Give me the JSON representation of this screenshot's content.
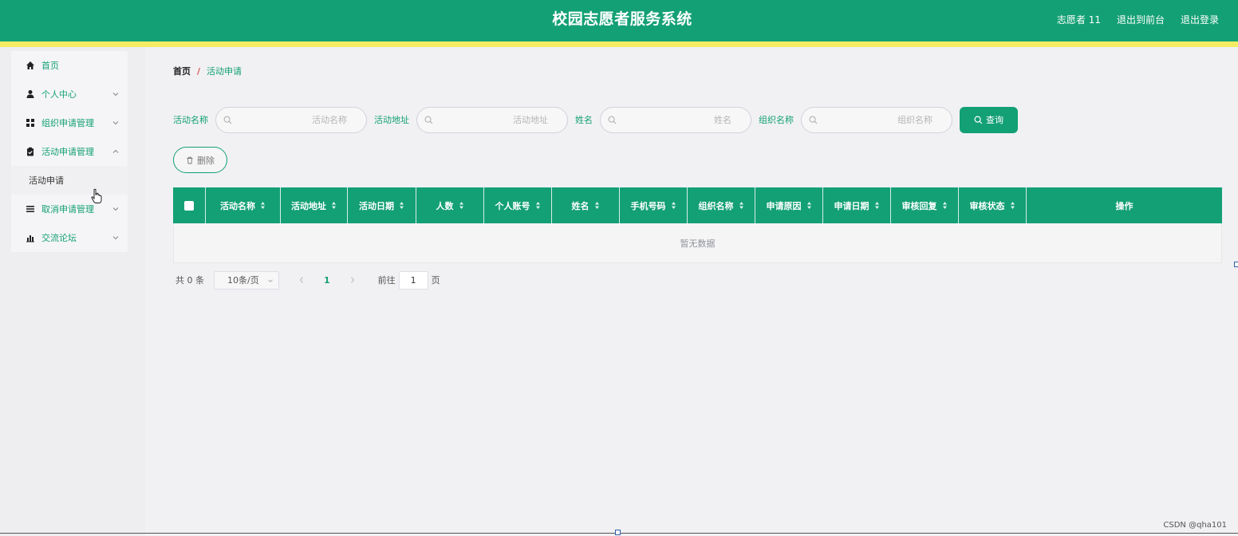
{
  "header": {
    "title": "校园志愿者服务系统",
    "user": "志愿者 11",
    "to_front": "退出到前台",
    "logout": "退出登录"
  },
  "colors": {
    "primary": "#13a074",
    "stripe": "#f4ed63",
    "background": "#f1f1f3"
  },
  "sidebar": {
    "items": [
      {
        "label": "首页",
        "icon": "home-icon",
        "has_children": false
      },
      {
        "label": "个人中心",
        "icon": "user-icon",
        "has_children": true
      },
      {
        "label": "组织申请管理",
        "icon": "grid-icon",
        "has_children": true
      },
      {
        "label": "活动申请管理",
        "icon": "clipboard-icon",
        "has_children": true
      },
      {
        "label": "取消申请管理",
        "icon": "list-icon",
        "has_children": true
      },
      {
        "label": "交流论坛",
        "icon": "bar-chart-icon",
        "has_children": true
      }
    ],
    "active_submenu": "活动申请"
  },
  "breadcrumb": {
    "home": "首页",
    "separator": "/",
    "current": "活动申请"
  },
  "search": {
    "fields": [
      {
        "label": "活动名称",
        "placeholder": "活动名称"
      },
      {
        "label": "活动地址",
        "placeholder": "活动地址"
      },
      {
        "label": "姓名",
        "placeholder": "姓名"
      },
      {
        "label": "组织名称",
        "placeholder": "组织名称"
      }
    ],
    "query_label": "查询"
  },
  "actions": {
    "delete_label": "删除"
  },
  "table": {
    "columns": [
      "活动名称",
      "活动地址",
      "活动日期",
      "人数",
      "个人账号",
      "姓名",
      "手机号码",
      "组织名称",
      "申请原因",
      "申请日期",
      "审核回复",
      "审核状态",
      "操作"
    ],
    "empty_text": "暂无数据"
  },
  "pagination": {
    "total_text": "共 0 条",
    "page_size": "10条/页",
    "current_page": "1",
    "goto_prefix": "前往",
    "goto_value": "1",
    "goto_suffix": "页"
  },
  "watermark": "CSDN @qha101"
}
